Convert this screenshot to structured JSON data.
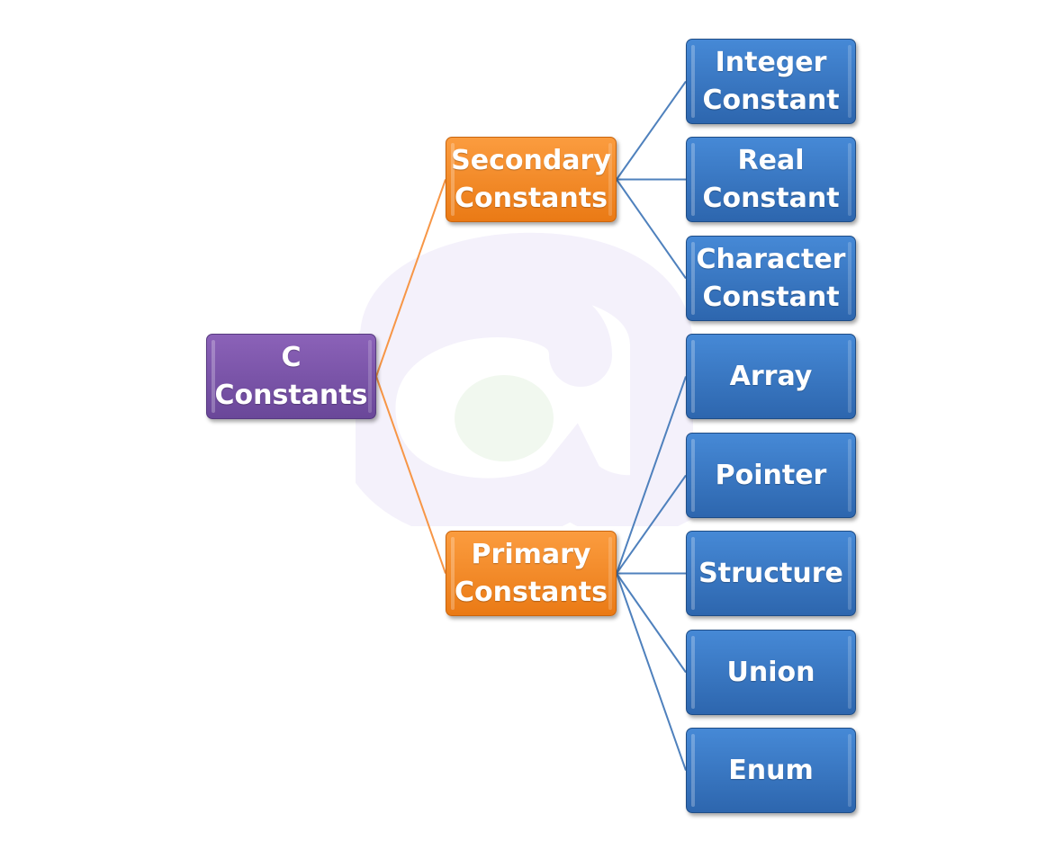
{
  "diagram": {
    "root": {
      "id": "root",
      "label": "C\nConstants",
      "color": "#7a55a8"
    },
    "groups": [
      {
        "id": "secondary",
        "label": "Secondary\nConstants",
        "color": "#f58a28",
        "children": [
          {
            "id": "integer",
            "label": "Integer\nConstant"
          },
          {
            "id": "real",
            "label": "Real\nConstant"
          },
          {
            "id": "character",
            "label": "Character\nConstant"
          }
        ]
      },
      {
        "id": "primary",
        "label": "Primary\nConstants",
        "color": "#f58a28",
        "children": [
          {
            "id": "array",
            "label": "Array"
          },
          {
            "id": "pointer",
            "label": "Pointer"
          },
          {
            "id": "structure",
            "label": "Structure"
          },
          {
            "id": "union",
            "label": "Union"
          },
          {
            "id": "enum",
            "label": "Enum"
          }
        ]
      }
    ],
    "colors": {
      "root_link": "#f79646",
      "child_link": "#4f81bd",
      "leaf": "#3a78c4"
    }
  }
}
